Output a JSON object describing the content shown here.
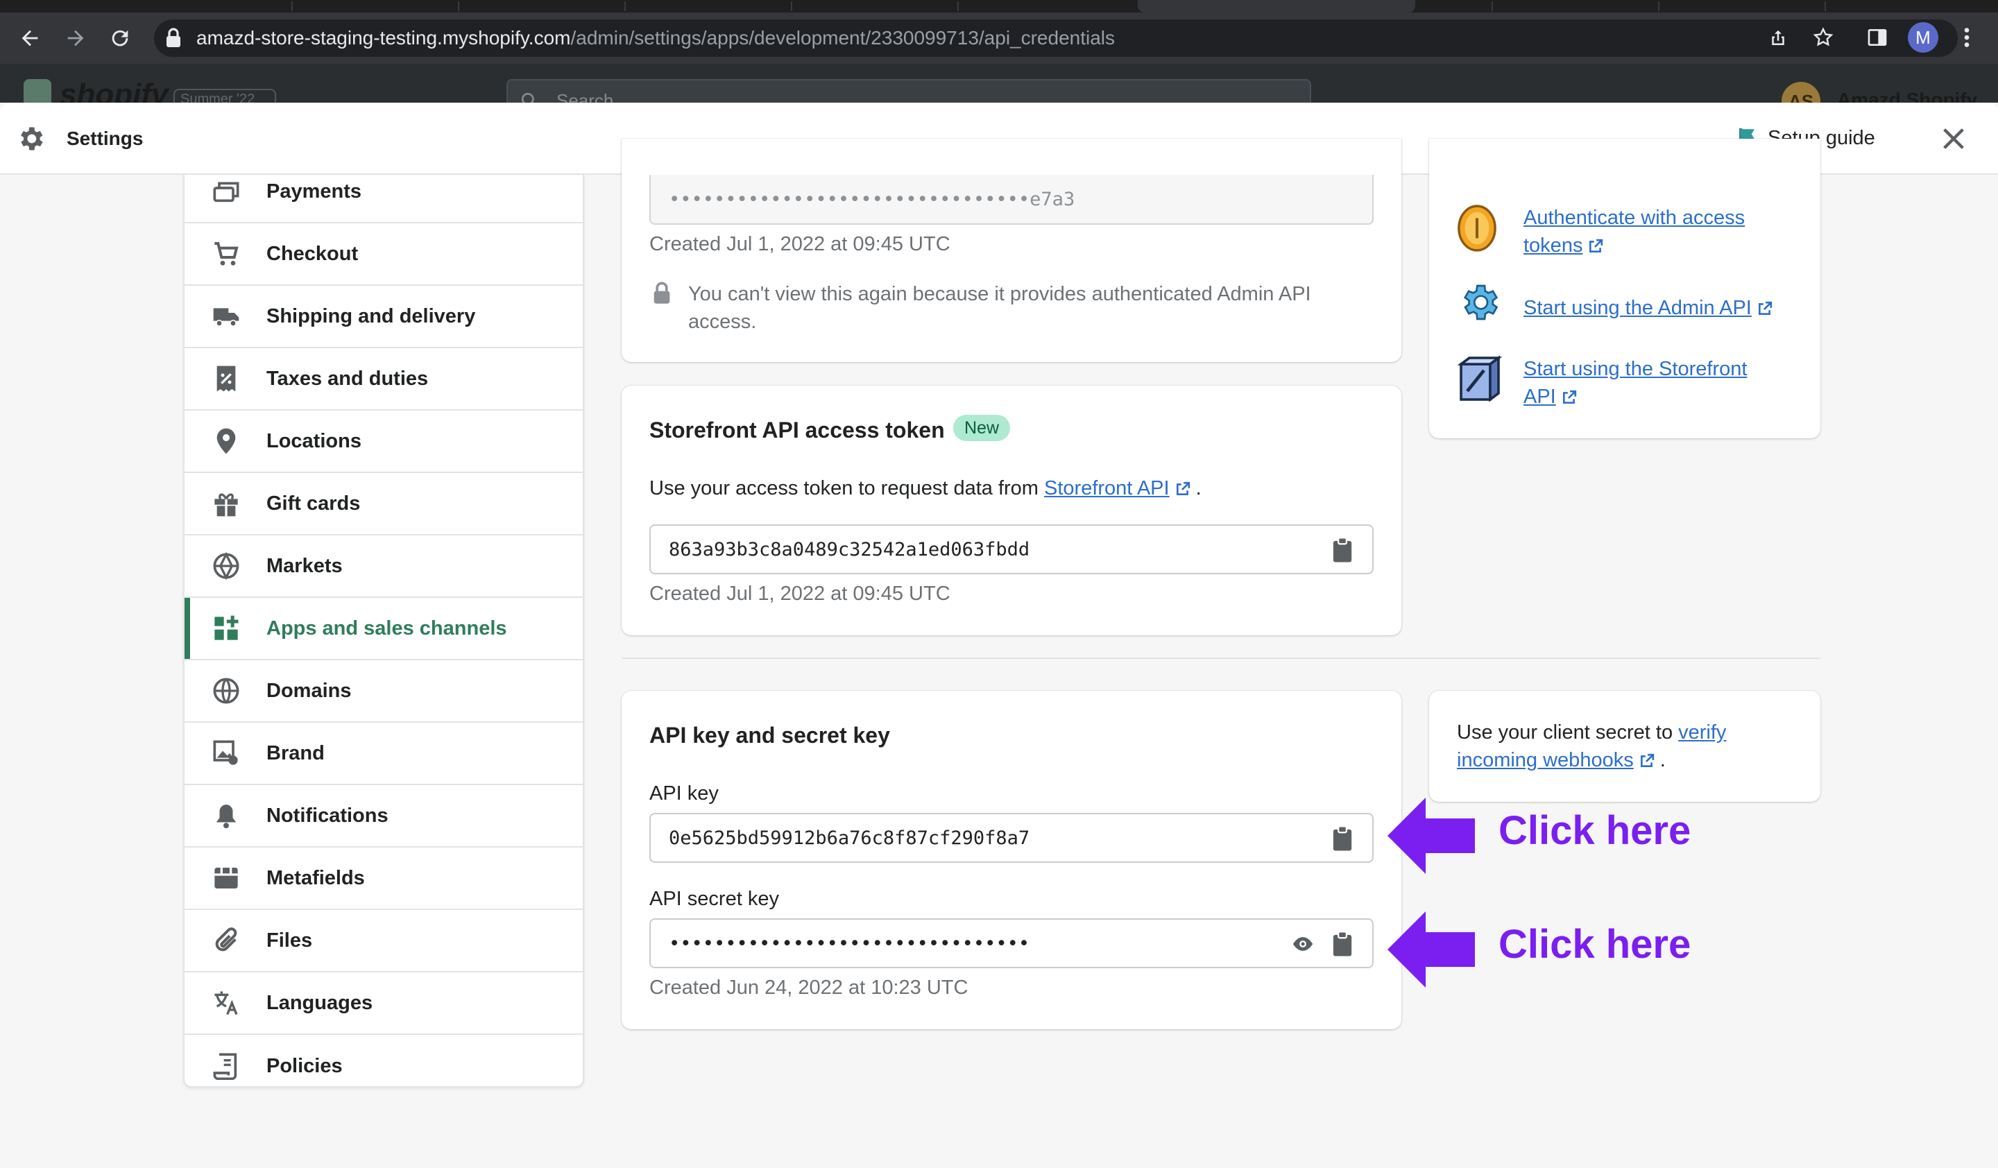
{
  "browser": {
    "url_host": "amazd-store-staging-testing.myshopify.com",
    "url_path": "/admin/settings/apps/development/2330099713/api_credentials",
    "profile_initial": "M"
  },
  "admin_backdrop": {
    "logo": "shopify",
    "version_badge": "Summer '22",
    "search_placeholder": "Search",
    "store_initials": "AS",
    "store_name": "Amazd Shopify"
  },
  "settings": {
    "title": "Settings",
    "setup_guide": "Setup guide"
  },
  "sidebar": {
    "items": [
      {
        "label": "Payments",
        "icon": "payments-icon"
      },
      {
        "label": "Checkout",
        "icon": "cart-icon"
      },
      {
        "label": "Shipping and delivery",
        "icon": "truck-icon"
      },
      {
        "label": "Taxes and duties",
        "icon": "receipt-icon"
      },
      {
        "label": "Locations",
        "icon": "location-pin-icon"
      },
      {
        "label": "Gift cards",
        "icon": "gift-icon"
      },
      {
        "label": "Markets",
        "icon": "globe-markets-icon"
      },
      {
        "label": "Apps and sales channels",
        "icon": "apps-icon",
        "active": true
      },
      {
        "label": "Domains",
        "icon": "globe-icon"
      },
      {
        "label": "Brand",
        "icon": "brand-icon"
      },
      {
        "label": "Notifications",
        "icon": "bell-icon"
      },
      {
        "label": "Metafields",
        "icon": "metafields-icon"
      },
      {
        "label": "Files",
        "icon": "paperclip-icon"
      },
      {
        "label": "Languages",
        "icon": "translate-icon"
      },
      {
        "label": "Policies",
        "icon": "policies-icon"
      }
    ]
  },
  "admin_token_card": {
    "masked_value": "••••••••••••••••••••••••••••••••e7a3",
    "created": "Created Jul 1, 2022 at 09:45 UTC",
    "warning": "You can't view this again because it provides authenticated Admin API",
    "warning_cont": "access."
  },
  "resources_card": {
    "links": [
      {
        "line1": "Authenticate with access",
        "line2": "tokens",
        "icon": "coin-icon"
      },
      {
        "line1": "Start using the Admin API",
        "line2": "",
        "icon": "gear-robot-icon"
      },
      {
        "line1": "Start using the Storefront",
        "line2": "API",
        "icon": "storefront-icon"
      }
    ]
  },
  "storefront_card": {
    "title": "Storefront API access token",
    "badge": "New",
    "desc_prefix": "Use your access token to request data from",
    "desc_link": "Storefront API",
    "desc_suffix": ".",
    "token": "863a93b3c8a0489c32542a1ed063fbdd",
    "created": "Created Jul 1, 2022 at 09:45 UTC"
  },
  "api_key_card": {
    "title": "API key and secret key",
    "api_key_label": "API key",
    "api_key": "0e5625bd59912b6a76c8f87cf290f8a7",
    "secret_label": "API secret key",
    "secret_masked": "••••••••••••••••••••••••••••••••",
    "created": "Created Jun 24, 2022 at 10:23 UTC"
  },
  "webhook_card": {
    "prefix": "Use your client secret to",
    "link_line1": "verify",
    "link_line2": "incoming webhooks",
    "suffix": "."
  },
  "annotations": {
    "click_1": "Click here",
    "click_2": "Click here",
    "color": "#7a1ff0"
  }
}
